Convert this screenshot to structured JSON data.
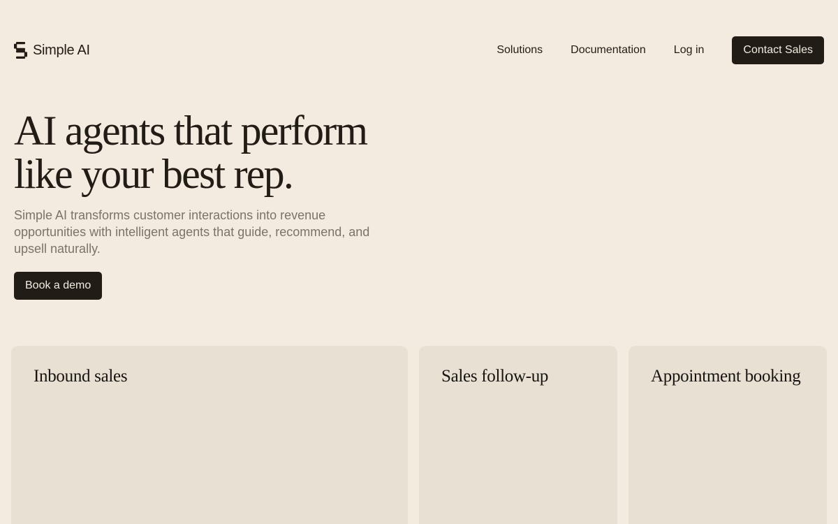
{
  "brand": {
    "name": "Simple AI",
    "logo_icon": "stacked-s-logo-icon"
  },
  "nav": {
    "links": [
      {
        "label": "Solutions"
      },
      {
        "label": "Documentation"
      },
      {
        "label": "Log in"
      }
    ],
    "cta_label": "Contact Sales"
  },
  "hero": {
    "title_line_1": "AI agents that perform",
    "title_line_2": "like your best rep.",
    "subtitle": "Simple AI transforms customer interactions into revenue opportunities with intelligent agents that guide, recommend, and upsell naturally.",
    "cta_label": "Book a demo"
  },
  "cards": [
    {
      "title": "Inbound sales"
    },
    {
      "title": "Sales follow-up"
    },
    {
      "title": "Appointment booking"
    }
  ],
  "colors": {
    "background": "#f3ebe0",
    "card_background": "#e8e1d3",
    "primary_dark": "#211c15",
    "muted_text": "#7b7369"
  }
}
